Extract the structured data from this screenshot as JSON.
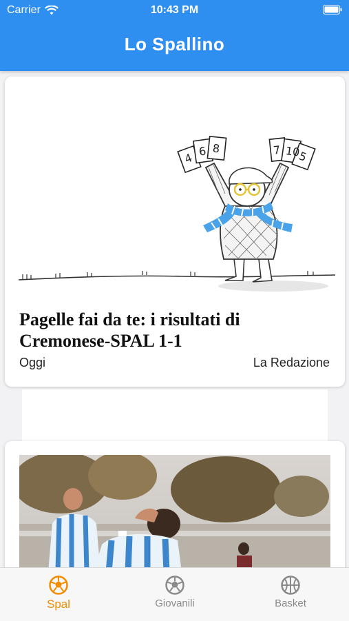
{
  "status_bar": {
    "carrier": "Carrier",
    "time": "10:43 PM"
  },
  "app": {
    "title": "Lo Spallino"
  },
  "articles": [
    {
      "title": "Pagelle fai da te: i risultati di Cremonese-SPAL 1-1",
      "date": "Oggi",
      "author": "La Redazione",
      "image": "cartoon-fan-holding-score-cards"
    },
    {
      "image": "football-match-photo"
    }
  ],
  "tabs": [
    {
      "label": "Spal",
      "icon": "soccer-ball-icon",
      "active": true
    },
    {
      "label": "Giovanili",
      "icon": "soccer-ball-icon",
      "active": false
    },
    {
      "label": "Basket",
      "icon": "basketball-icon",
      "active": false
    }
  ],
  "colors": {
    "header": "#2f8ff0",
    "active_tab": "#f28b00",
    "inactive_tab": "#8a8a8a"
  }
}
